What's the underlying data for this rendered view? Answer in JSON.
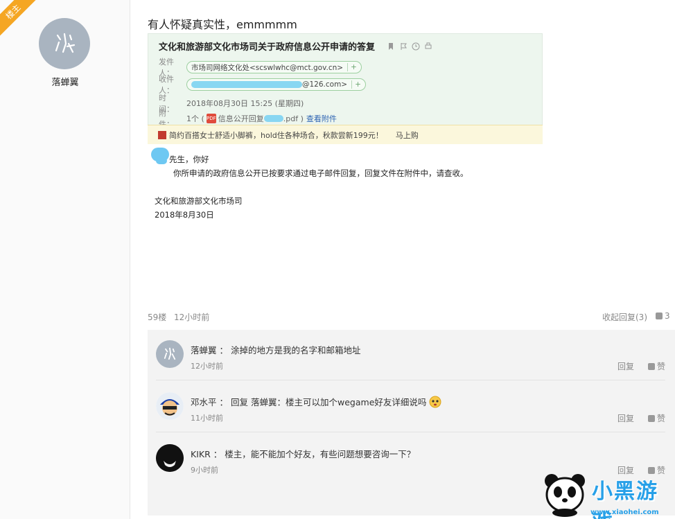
{
  "author": {
    "badge": "楼主",
    "name": "落蝉翼"
  },
  "post": {
    "title": "有人怀疑真实性，emmmmm",
    "mail": {
      "subject": "文化和旅游部文化市场司关于政府信息公开申请的答复",
      "from_label": "发件人：",
      "from_value": "市场司网络文化处<scswlwhc@mct.gov.cn>",
      "to_label": "收件人：",
      "to_value": "@126.com>",
      "time_label": "时　间：",
      "time_value": "2018年08月30日 15:25 (星期四)",
      "attach_label": "附　件：",
      "attach_count": "1个 (",
      "attach_name": "信息公开回复",
      "attach_ext": ".pdf )",
      "attach_view": "查看附件",
      "ad_text": "简约百搭女士舒适小脚裤，hold住各种场合，秋款尝新199元！",
      "ad_link": "马上购"
    },
    "greeting": "先生，你好",
    "body": "你所申请的政府信息公开已按要求通过电子邮件回复，回复文件在附件中，请查收。",
    "sign_org": "文化和旅游部文化市场司",
    "sign_date": "2018年8月30日"
  },
  "meta": {
    "floor": "59楼",
    "time": "12小时前",
    "collapse": "收起回复(3)",
    "likes": "3"
  },
  "comments": [
    {
      "name": "落蝉翼",
      "sep": "：",
      "text": "涂掉的地方是我的名字和邮箱地址",
      "time": "12小时前",
      "reply": "回复",
      "like": "赞"
    },
    {
      "name": "邓水平",
      "sep": "：",
      "prefix": "回复",
      "target": "落蝉翼",
      "text": "：楼主可以加个wegame好友详细说吗",
      "time": "11小时前",
      "reply": "回复",
      "like": "赞"
    },
    {
      "name": "KIKR",
      "sep": "：",
      "text": "楼主，能不能加个好友，有些问题想要咨询一下？",
      "time": "9小时前",
      "reply": "回复",
      "like": "赞"
    }
  ],
  "watermark": {
    "text": "小黑游戏",
    "url": "www.xiaohei.com"
  }
}
